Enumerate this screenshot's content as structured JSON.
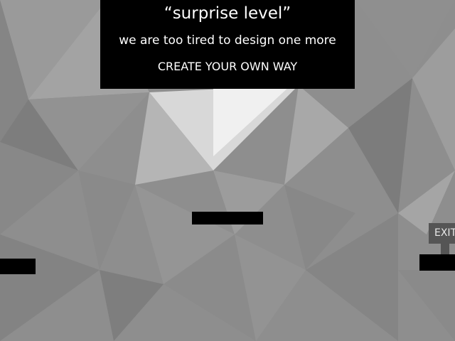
{
  "title_panel": {
    "title": "“surprise level”",
    "subtitle": "we are too tired to design one more",
    "instruction": "CREATE YOUR OWN WAY"
  },
  "exit_label": "EXIT",
  "colors": {
    "background": "#8e8e8e",
    "panel": "#000000",
    "text": "#ffffff",
    "exit_sign": "#555555",
    "platform": "#000000"
  }
}
